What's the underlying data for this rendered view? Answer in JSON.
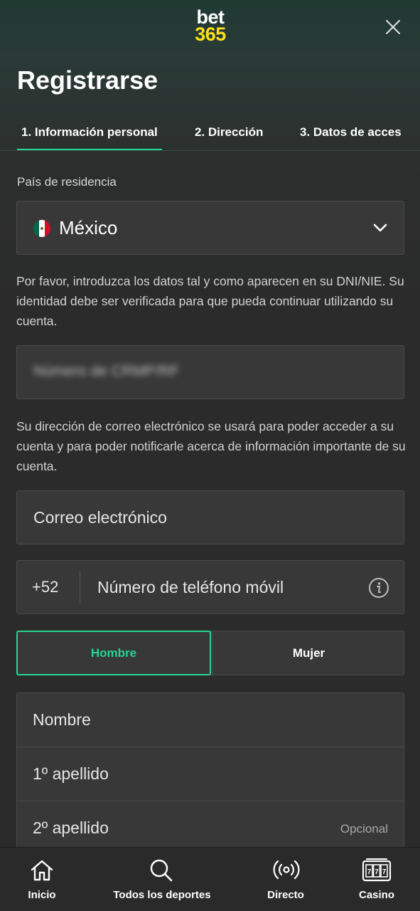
{
  "header": {
    "logo_line1": "bet",
    "logo_line2": "365",
    "title": "Registrarse"
  },
  "steps": [
    {
      "label": "1.  Información personal",
      "active": true
    },
    {
      "label": "2.  Dirección",
      "active": false
    },
    {
      "label": "3.  Datos de acces",
      "active": false
    }
  ],
  "country": {
    "label": "País de residencia",
    "value": "México",
    "flag_colors": [
      "#006847",
      "#ffffff",
      "#ce1126"
    ]
  },
  "id_notice": "Por favor, introduzca los datos tal y como aparecen en su DNI/NIE. Su identidad debe ser verificada para que pueda continuar utilizando su cuenta.",
  "id_field": {
    "placeholder_blurred": "Número de CRMP/RF"
  },
  "email_notice": "Su dirección de correo electrónico se usará para poder acceder a su cuenta y para poder notificarle acerca de información importante de su cuenta.",
  "email_field": {
    "placeholder": "Correo electrónico"
  },
  "phone_field": {
    "prefix": "+52",
    "placeholder": "Número de teléfono móvil"
  },
  "gender": {
    "male": "Hombre",
    "female": "Mujer",
    "selected": "Hombre"
  },
  "names": {
    "first": "Nombre",
    "surname1": "1º apellido",
    "surname2": "2º apellido",
    "optional": "Opcional"
  },
  "bottom_nav": [
    {
      "label": "Inicio",
      "icon": "home-icon"
    },
    {
      "label": "Todos los deportes",
      "icon": "search-icon"
    },
    {
      "label": "Directo",
      "icon": "live-broadcast-icon"
    },
    {
      "label": "Casino",
      "icon": "slot-machine-icon"
    }
  ],
  "colors": {
    "accent": "#26d493",
    "logo_yellow": "#ffdf1b",
    "field_bg": "#383838"
  }
}
